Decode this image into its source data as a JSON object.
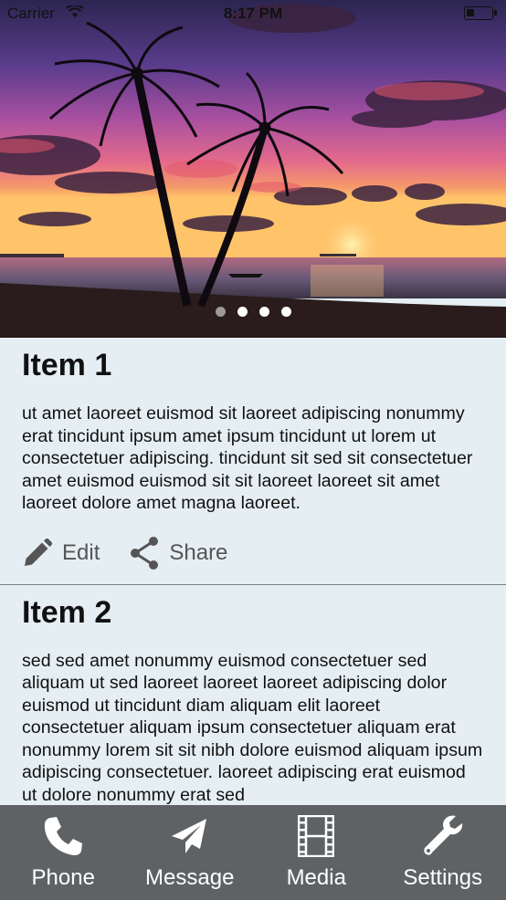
{
  "status_bar": {
    "carrier": "Carrier",
    "time": "8:17 PM"
  },
  "carousel": {
    "page_count": 4,
    "active_index": 0
  },
  "items": [
    {
      "title": "Item 1",
      "body": "ut amet laoreet euismod sit laoreet adipiscing nonummy erat tincidunt ipsum amet ipsum tincidunt ut lorem ut consectetuer adipiscing. tincidunt sit sed sit consectetuer amet euismod euismod sit sit laoreet laoreet sit amet laoreet dolore amet magna laoreet.",
      "edit_label": "Edit",
      "share_label": "Share"
    },
    {
      "title": "Item 2",
      "body": "sed sed amet nonummy euismod consectetuer sed aliquam ut sed laoreet laoreet laoreet adipiscing dolor euismod ut tincidunt diam aliquam elit laoreet consectetuer aliquam ipsum consectetuer aliquam erat nonummy lorem sit sit nibh dolore euismod aliquam ipsum adipiscing consectetuer. laoreet adipiscing erat euismod ut dolore nonummy erat sed"
    }
  ],
  "tab_bar": {
    "tabs": [
      {
        "label": "Phone",
        "icon": "phone-icon"
      },
      {
        "label": "Message",
        "icon": "paper-plane-icon"
      },
      {
        "label": "Media",
        "icon": "film-icon"
      },
      {
        "label": "Settings",
        "icon": "wrench-icon"
      }
    ]
  },
  "colors": {
    "background": "#e5eff3",
    "tab_bar": "#5f6264",
    "action_text": "#555555"
  }
}
